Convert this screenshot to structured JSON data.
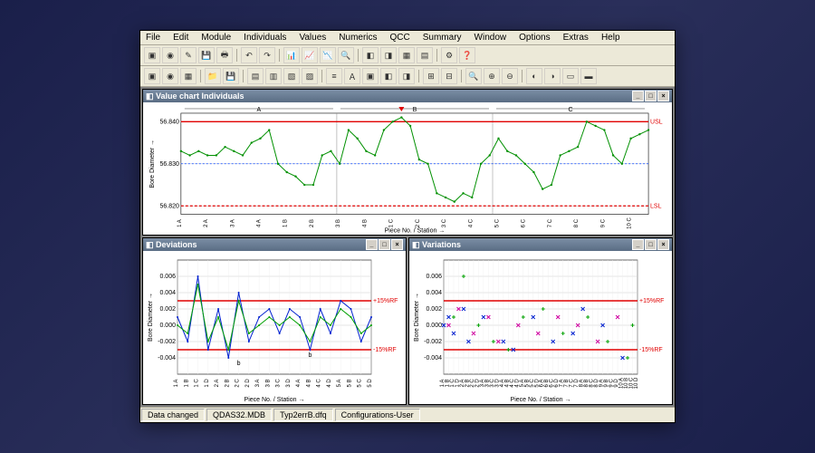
{
  "menu": [
    "File",
    "Edit",
    "Module",
    "Individuals",
    "Values",
    "Numerics",
    "QCC",
    "Summary",
    "Window",
    "Options",
    "Extras",
    "Help"
  ],
  "windows": {
    "top": {
      "title": "Value chart Individuals"
    },
    "bl": {
      "title": "Deviations"
    },
    "br": {
      "title": "Variations"
    }
  },
  "axis": {
    "ylabel": "Bore Diameter →",
    "xlabel": "Piece No. / Station →"
  },
  "status": {
    "a": "Data changed",
    "b": "QDAS32.MDB",
    "c": "Typ2errB.dfq",
    "d": "Configurations-User"
  },
  "limits": {
    "usl": "USL",
    "lsl": "LSL",
    "p15rf": "+15%RF",
    "m15rf": "-15%RF"
  },
  "groups": [
    "A",
    "B",
    "C"
  ],
  "chart_data": [
    {
      "name": "Value chart Individuals",
      "type": "line",
      "xlabel": "Piece No. / Station →",
      "ylabel": "Bore Diameter →",
      "ylim": [
        56.818,
        56.842
      ],
      "yticks": [
        56.82,
        56.83,
        56.84
      ],
      "usl": 56.84,
      "lsl": 56.82,
      "center": 56.83,
      "x_categories": [
        "1 A",
        "1 A",
        "1 A",
        "2 A",
        "2 A",
        "2 A",
        "3 A",
        "3 A",
        "3 A",
        "4 A",
        "4 A",
        "4 A",
        "1 B",
        "1 B",
        "1 B",
        "2 B",
        "2 B",
        "2 B",
        "3 B",
        "3 B",
        "3 B",
        "4 B",
        "4 B",
        "4 B",
        "1 C",
        "1 C",
        "1 C",
        "2 C",
        "2 C",
        "2 C",
        "3 C",
        "3 C",
        "3 C",
        "4 C",
        "4 C",
        "4 C",
        "5 C",
        "5 C",
        "5 C",
        "6 C",
        "6 C",
        "6 C",
        "7 C",
        "7 C",
        "7 C",
        "8 C",
        "8 C",
        "8 C",
        "9 C",
        "9 C",
        "9 C",
        "10 C",
        "10 C",
        "10 C"
      ],
      "values": [
        56.833,
        56.832,
        56.833,
        56.832,
        56.832,
        56.834,
        56.833,
        56.832,
        56.835,
        56.836,
        56.838,
        56.83,
        56.828,
        56.827,
        56.825,
        56.825,
        56.832,
        56.833,
        56.83,
        56.838,
        56.836,
        56.833,
        56.832,
        56.838,
        56.84,
        56.841,
        56.839,
        56.831,
        56.83,
        56.823,
        56.822,
        56.821,
        56.823,
        56.822,
        56.83,
        56.832,
        56.836,
        56.833,
        56.832,
        56.83,
        56.828,
        56.824,
        56.825,
        56.832,
        56.833,
        56.834,
        56.84,
        56.839,
        56.838,
        56.832,
        56.83,
        56.836,
        56.837,
        56.838
      ],
      "group_dividers": [
        "A",
        "B",
        "C"
      ]
    },
    {
      "name": "Deviations",
      "type": "line",
      "xlabel": "Piece No. / Station →",
      "ylabel": "Bore Diameter →",
      "ylim": [
        -0.006,
        0.008
      ],
      "yticks": [
        -0.004,
        -0.002,
        0.0,
        0.002,
        0.004,
        0.006
      ],
      "upper_ref": 0.003,
      "lower_ref": -0.003,
      "ref_labels": {
        "upper": "+15%RF",
        "lower": "-15%RF"
      },
      "x_categories": [
        "1 A",
        "1 B",
        "1 C",
        "1 D",
        "2 A",
        "2 B",
        "2 C",
        "2 D",
        "3 A",
        "3 B",
        "3 C",
        "3 D",
        "4 A",
        "4 B",
        "4 C",
        "4 D",
        "5 A",
        "5 B",
        "5 C",
        "5 D"
      ],
      "series": [
        {
          "name": "blue",
          "color": "#0020d0",
          "values": [
            0.001,
            -0.002,
            0.006,
            -0.003,
            0.002,
            -0.004,
            0.004,
            -0.002,
            0.001,
            0.002,
            -0.001,
            0.002,
            0.001,
            -0.003,
            0.002,
            -0.001,
            0.003,
            0.002,
            -0.002,
            0.001
          ]
        },
        {
          "name": "green",
          "color": "#00a000",
          "values": [
            0.0,
            -0.001,
            0.005,
            -0.002,
            0.001,
            -0.003,
            0.003,
            -0.001,
            0.0,
            0.001,
            0.0,
            0.001,
            0.0,
            -0.002,
            0.001,
            0.0,
            0.002,
            0.001,
            -0.001,
            0.0
          ]
        }
      ],
      "annot": [
        {
          "x": 6,
          "y": -0.004,
          "t": "b"
        },
        {
          "x": 13,
          "y": -0.003,
          "t": "b"
        }
      ]
    },
    {
      "name": "Variations",
      "type": "scatter",
      "xlabel": "Piece No. / Station →",
      "ylabel": "Bore Diameter →",
      "ylim": [
        -0.006,
        0.008
      ],
      "yticks": [
        -0.004,
        -0.002,
        0.0,
        0.002,
        0.004,
        0.006
      ],
      "upper_ref": 0.003,
      "lower_ref": -0.003,
      "ref_labels": {
        "upper": "+15%RF",
        "lower": "-15%RF"
      },
      "x_categories": [
        "1 A",
        "1 B",
        "1 C",
        "1 D",
        "2 A",
        "2 B",
        "2 C",
        "2 D",
        "3 A",
        "3 B",
        "3 C",
        "3 D",
        "4 A",
        "4 B",
        "4 C",
        "4 D",
        "5 A",
        "5 B",
        "5 C",
        "5 D",
        "6 A",
        "6 B",
        "6 C",
        "6 D",
        "7 A",
        "7 B",
        "7 C",
        "7 D",
        "8 A",
        "8 B",
        "8 C",
        "8 D",
        "9 A",
        "9 B",
        "9 C",
        "9 D",
        "10 A",
        "10 B",
        "10 C",
        "10 D"
      ],
      "series": [
        {
          "name": "blue",
          "color": "#0020d0",
          "mark": "x",
          "points": [
            [
              0,
              0.0
            ],
            [
              1,
              0.001
            ],
            [
              2,
              -0.001
            ],
            [
              4,
              0.002
            ],
            [
              5,
              -0.002
            ],
            [
              8,
              0.001
            ],
            [
              12,
              -0.002
            ],
            [
              14,
              -0.003
            ],
            [
              18,
              0.001
            ],
            [
              22,
              -0.002
            ],
            [
              26,
              -0.001
            ],
            [
              28,
              0.002
            ],
            [
              32,
              0.0
            ],
            [
              36,
              -0.004
            ]
          ]
        },
        {
          "name": "magenta",
          "color": "#d000a0",
          "mark": "x",
          "points": [
            [
              1,
              0.0
            ],
            [
              3,
              0.002
            ],
            [
              6,
              -0.001
            ],
            [
              9,
              0.001
            ],
            [
              11,
              -0.002
            ],
            [
              15,
              0.0
            ],
            [
              19,
              -0.001
            ],
            [
              23,
              0.001
            ],
            [
              27,
              0.0
            ],
            [
              31,
              -0.002
            ],
            [
              35,
              0.001
            ]
          ]
        },
        {
          "name": "green",
          "color": "#00a000",
          "mark": "+",
          "points": [
            [
              2,
              0.001
            ],
            [
              4,
              0.006
            ],
            [
              7,
              0.0
            ],
            [
              10,
              -0.002
            ],
            [
              13,
              -0.003
            ],
            [
              16,
              0.001
            ],
            [
              20,
              0.002
            ],
            [
              24,
              -0.001
            ],
            [
              29,
              0.001
            ],
            [
              33,
              -0.002
            ],
            [
              37,
              -0.004
            ],
            [
              38,
              0.0
            ]
          ]
        }
      ]
    }
  ]
}
